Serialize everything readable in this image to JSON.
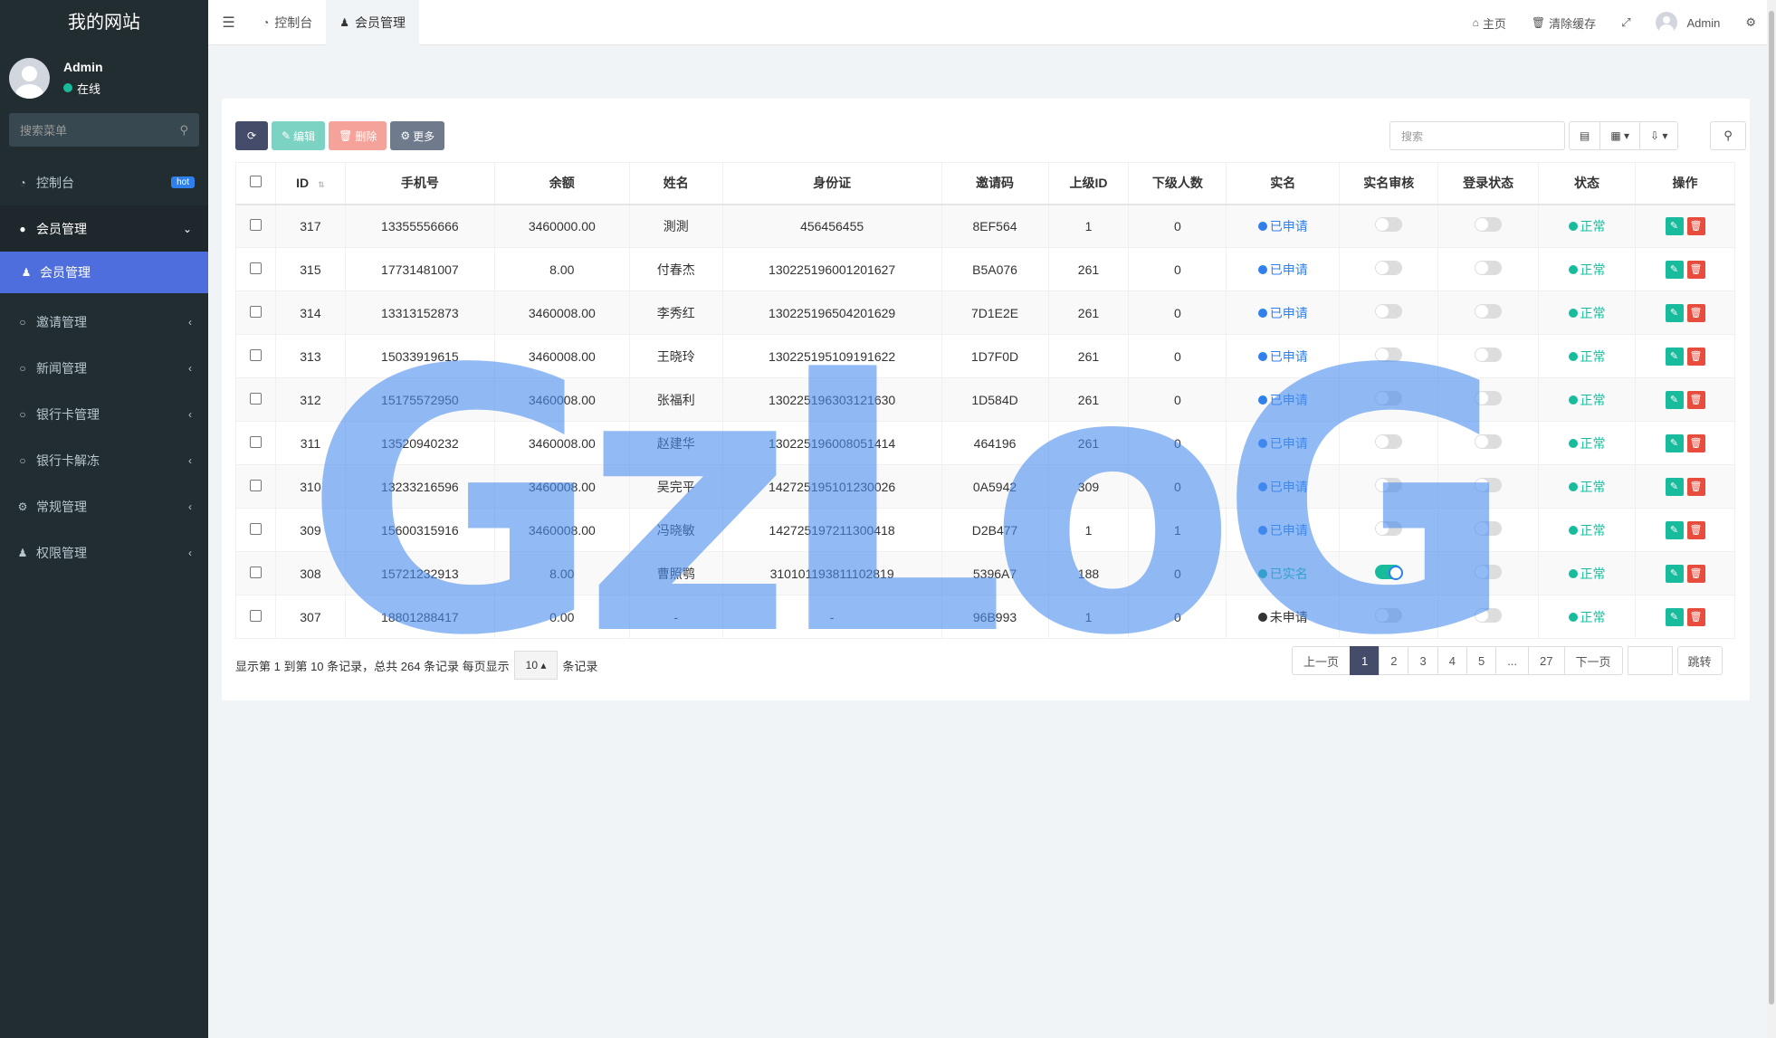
{
  "brand": "我的网站",
  "user": {
    "name": "Admin",
    "status": "在线"
  },
  "sidebar": {
    "search_placeholder": "搜索菜单",
    "items": [
      {
        "label": "控制台",
        "badge": "hot"
      },
      {
        "label": "会员管理"
      },
      {
        "label": "会员管理"
      },
      {
        "label": "邀请管理"
      },
      {
        "label": "新闻管理"
      },
      {
        "label": "银行卡管理"
      },
      {
        "label": "银行卡解冻"
      },
      {
        "label": "常规管理"
      },
      {
        "label": "权限管理"
      }
    ]
  },
  "header": {
    "tabs": [
      {
        "label": "控制台"
      },
      {
        "label": "会员管理"
      }
    ],
    "links": {
      "home": "主页",
      "clear_cache": "清除缓存",
      "admin": "Admin"
    }
  },
  "toolbar": {
    "edit": "编辑",
    "delete": "删除",
    "more": "更多",
    "search_placeholder": "搜索"
  },
  "table": {
    "columns": [
      "ID",
      "手机号",
      "余额",
      "姓名",
      "身份证",
      "邀请码",
      "上级ID",
      "下级人数",
      "实名",
      "实名审核",
      "登录状态",
      "状态",
      "操作"
    ],
    "rows": [
      {
        "id": "317",
        "phone": "13355556666",
        "balance": "3460000.00",
        "name": "測測",
        "idcard": "456456455",
        "code": "8EF564",
        "parent": "1",
        "sub": "0",
        "realname": "已申请",
        "audit": false,
        "login": false,
        "status": "正常"
      },
      {
        "id": "315",
        "phone": "17731481007",
        "balance": "8.00",
        "name": "付春杰",
        "idcard": "130225196001201627",
        "code": "B5A076",
        "parent": "261",
        "sub": "0",
        "realname": "已申请",
        "audit": false,
        "login": false,
        "status": "正常"
      },
      {
        "id": "314",
        "phone": "13313152873",
        "balance": "3460008.00",
        "name": "李秀红",
        "idcard": "130225196504201629",
        "code": "7D1E2E",
        "parent": "261",
        "sub": "0",
        "realname": "已申请",
        "audit": false,
        "login": false,
        "status": "正常"
      },
      {
        "id": "313",
        "phone": "15033919615",
        "balance": "3460008.00",
        "name": "王晓玲",
        "idcard": "130225195109191622",
        "code": "1D7F0D",
        "parent": "261",
        "sub": "0",
        "realname": "已申请",
        "audit": false,
        "login": false,
        "status": "正常"
      },
      {
        "id": "312",
        "phone": "15175572950",
        "balance": "3460008.00",
        "name": "张福利",
        "idcard": "130225196303121630",
        "code": "1D584D",
        "parent": "261",
        "sub": "0",
        "realname": "已申请",
        "audit": false,
        "login": false,
        "status": "正常"
      },
      {
        "id": "311",
        "phone": "13520940232",
        "balance": "3460008.00",
        "name": "赵建华",
        "idcard": "130225196008051414",
        "code": "464196",
        "parent": "261",
        "sub": "0",
        "realname": "已申请",
        "audit": false,
        "login": false,
        "status": "正常"
      },
      {
        "id": "310",
        "phone": "13233216596",
        "balance": "3460008.00",
        "name": "吴完平",
        "idcard": "142725195101230026",
        "code": "0A5942",
        "parent": "309",
        "sub": "0",
        "realname": "已申请",
        "audit": false,
        "login": false,
        "status": "正常"
      },
      {
        "id": "309",
        "phone": "15600315916",
        "balance": "3460008.00",
        "name": "冯晓敏",
        "idcard": "142725197211300418",
        "code": "D2B477",
        "parent": "1",
        "sub": "1",
        "realname": "已申请",
        "audit": false,
        "login": false,
        "status": "正常"
      },
      {
        "id": "308",
        "phone": "15721232913",
        "balance": "8.00",
        "name": "曹照鹗",
        "idcard": "310101193811102819",
        "code": "5396A7",
        "parent": "188",
        "sub": "0",
        "realname": "已实名",
        "audit": true,
        "login": false,
        "status": "正常"
      },
      {
        "id": "307",
        "phone": "18801288417",
        "balance": "0.00",
        "name": "-",
        "idcard": "-",
        "code": "96B993",
        "parent": "1",
        "sub": "0",
        "realname": "未申请",
        "audit": false,
        "login": false,
        "status": "正常"
      }
    ]
  },
  "footer": {
    "info_prefix": "显示第 1 到第 10 条记录，总共 264 条记录 每页显示",
    "page_size": "10",
    "info_suffix": "条记录",
    "pages": [
      "上一页",
      "1",
      "2",
      "3",
      "4",
      "5",
      "...",
      "27",
      "下一页"
    ],
    "jump": "跳转"
  },
  "watermark": "GzLoG",
  "colors": {
    "sidebar": "#222d32",
    "accent": "#4d6edc",
    "teal": "#18bc9c",
    "red": "#e74c3c",
    "blue": "#2f80ed"
  }
}
